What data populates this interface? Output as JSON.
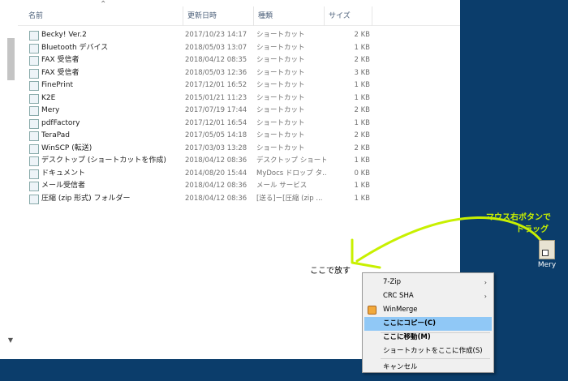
{
  "header": {
    "name": "名前",
    "date": "更新日時",
    "type": "種類",
    "size": "サイズ"
  },
  "files": [
    {
      "name": "Becky! Ver.2",
      "date": "2017/10/23 14:17",
      "type": "ショートカット",
      "size": "2 KB"
    },
    {
      "name": "Bluetooth デバイス",
      "date": "2018/05/03 13:07",
      "type": "ショートカット",
      "size": "1 KB"
    },
    {
      "name": "FAX 受信者",
      "date": "2018/04/12 08:35",
      "type": "ショートカット",
      "size": "2 KB"
    },
    {
      "name": "FAX 受信者",
      "date": "2018/05/03 12:36",
      "type": "ショートカット",
      "size": "3 KB"
    },
    {
      "name": "FinePrint",
      "date": "2017/12/01 16:52",
      "type": "ショートカット",
      "size": "1 KB"
    },
    {
      "name": "K2E",
      "date": "2015/01/21 11:23",
      "type": "ショートカット",
      "size": "1 KB"
    },
    {
      "name": "Mery",
      "date": "2017/07/19 17:44",
      "type": "ショートカット",
      "size": "2 KB"
    },
    {
      "name": "pdfFactory",
      "date": "2017/12/01 16:54",
      "type": "ショートカット",
      "size": "1 KB"
    },
    {
      "name": "TeraPad",
      "date": "2017/05/05 14:18",
      "type": "ショートカット",
      "size": "2 KB"
    },
    {
      "name": "WinSCP (転送)",
      "date": "2017/03/03 13:28",
      "type": "ショートカット",
      "size": "2 KB"
    },
    {
      "name": "デスクトップ (ショートカットを作成)",
      "date": "2018/04/12 08:36",
      "type": "デスクトップ ショートカ",
      "size": "1 KB"
    },
    {
      "name": "ドキュメント",
      "date": "2014/08/20 15:44",
      "type": "MyDocs ドロップ タ...",
      "size": "0 KB"
    },
    {
      "name": "メール受信者",
      "date": "2018/04/12 08:36",
      "type": "メール サービス",
      "size": "1 KB"
    },
    {
      "name": "圧縮 (zip 形式) フォルダー",
      "date": "2018/04/12 08:36",
      "type": "[送る]ー[圧縮 (zip ...",
      "size": "1 KB"
    }
  ],
  "annotation": {
    "drag_line1": "マウス右ボタンで",
    "drag_line2": "ドラッグ",
    "drop": "ここで放す",
    "arrow_color": "#c8f000"
  },
  "desktop_icon": {
    "label": "Mery",
    "icon": "mery-shortcut-icon"
  },
  "context_menu": {
    "items": [
      {
        "label": "7-Zip",
        "submenu": true
      },
      {
        "label": "CRC SHA",
        "submenu": true
      },
      {
        "label": "WinMerge",
        "icon": "winmerge-icon"
      },
      {
        "label": "ここにコピー(C)",
        "highlighted": true,
        "bold": true
      },
      {
        "label": "ここに移動(M)",
        "bold": true
      },
      {
        "label": "ショートカットをここに作成(S)"
      },
      {
        "label": "キャンセル"
      }
    ],
    "highlight_color": "#90c8f6"
  },
  "colors": {
    "desktop": "#0b3d6b",
    "header_text": "#4c607a"
  }
}
